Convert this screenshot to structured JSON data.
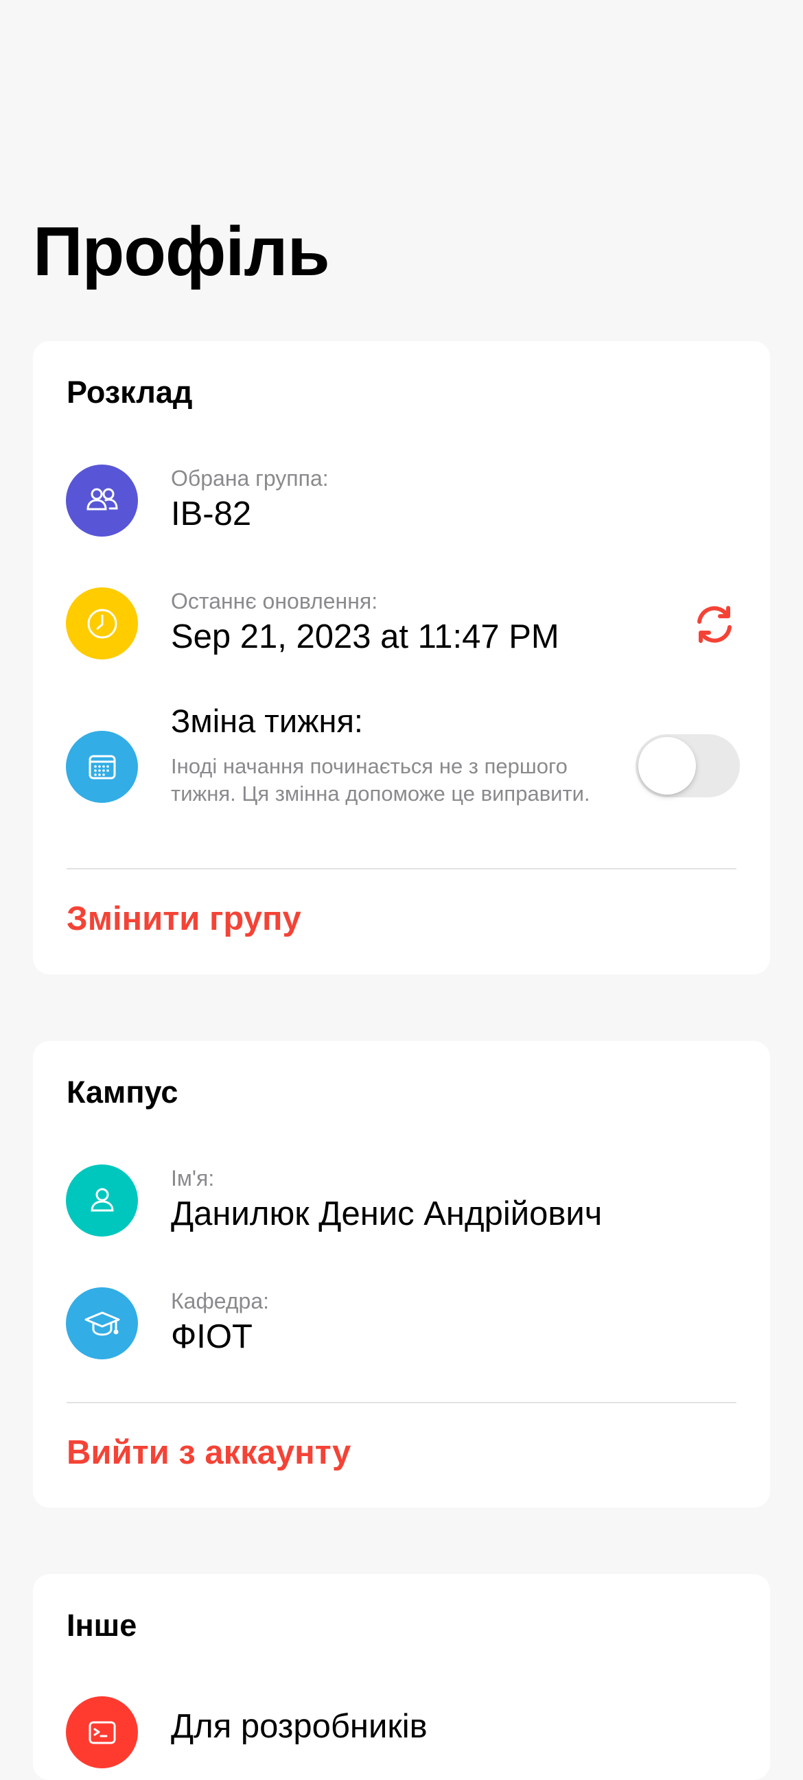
{
  "page": {
    "title": "Профіль"
  },
  "schedule": {
    "title": "Розклад",
    "group": {
      "label": "Обрана группа:",
      "value": "ІВ-82",
      "icon": "people-icon",
      "color": "#5856d6"
    },
    "last_update": {
      "label": "Останнє оновлення:",
      "value": "Sep 21, 2023 at 11:47 PM",
      "icon": "clock-icon",
      "color": "#ffcc00",
      "refresh_icon": "refresh-icon"
    },
    "week_change": {
      "title": "Зміна тижня:",
      "description": "Іноді начання починається не з першого тижня. Ця змінна допоможе це виправити.",
      "icon": "calendar-icon",
      "color": "#32ade6",
      "enabled": false
    },
    "action": "Змінити групу"
  },
  "campus": {
    "title": "Кампус",
    "name": {
      "label": "Ім'я:",
      "value": "Данилюк Денис Андрійович",
      "icon": "person-icon",
      "color": "#00c7be"
    },
    "department": {
      "label": "Кафедра:",
      "value": "ФІОТ",
      "icon": "graduation-cap-icon",
      "color": "#32ade6"
    },
    "action": "Вийти з аккаунту"
  },
  "other": {
    "title": "Інше",
    "developers": {
      "label": "Для розробників",
      "icon": "terminal-icon",
      "color": "#ff3b30"
    }
  },
  "colors": {
    "accent": "#f44336",
    "background": "#f7f7f7"
  }
}
